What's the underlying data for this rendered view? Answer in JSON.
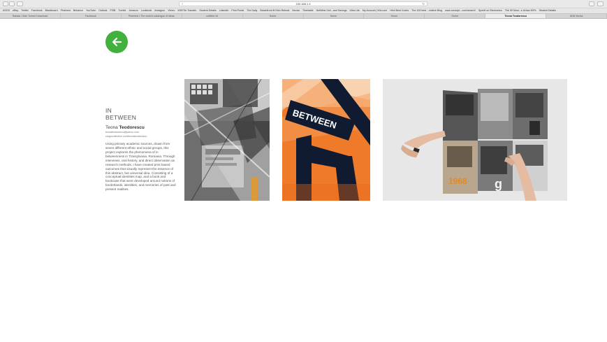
{
  "browser": {
    "url": "192.168.1.4",
    "bookmarks": [
      "ASOS",
      "eBay",
      "Twitter",
      "Facebook",
      "Blackboard",
      "Pinterest",
      "Behance",
      "YouTube",
      "Outlook",
      "FISB",
      "Tumblr",
      "Amazon",
      "Lookbook",
      "Instagrue",
      "Vimeo",
      "Wifi File Transfer",
      "Student Details",
      "LinkedIn",
      "Print Portal",
      "The Daily",
      "Beachfront B+Nim Retreat",
      "Nectar",
      "Timetable",
      "NetWest Onli...and Savings",
      "Ultra Lite",
      "My Account | Wix.com",
      "Html Best Codes",
      "The 100 best ...reative Blog",
      "www.concept...com/search/",
      "Sportif on Electronics",
      "The 50 Most...e Urban 50Fx",
      "Student Details"
    ],
    "tabs": [
      {
        "label": "Rakata / Man Torrent Download",
        "active": false
      },
      {
        "label": "Facebook",
        "active": false
      },
      {
        "label": "Pinterest • The world's catalogue of ideas",
        "active": false
      },
      {
        "label": "untitled 16",
        "active": false
      },
      {
        "label": "Home",
        "active": false
      },
      {
        "label": "Home",
        "active": false
      },
      {
        "label": "Home",
        "active": false
      },
      {
        "label": "Home",
        "active": false
      },
      {
        "label": "Teona Teodorescu",
        "active": true
      },
      {
        "label": "ANN Works",
        "active": false
      }
    ]
  },
  "back_button": {
    "icon": "arrow-left-icon",
    "color": "#41b03c"
  },
  "project": {
    "title_line1": "IN",
    "title_line2": "BETWEEN",
    "author_first": "Teona ",
    "author_last": "Teodorescu",
    "email": "teonateodorescu@yahoo.com",
    "website": "cargocollective.com/teonateodorescu",
    "description": "Using primary academic sources, drawn from seven different ethnic and social groups, this project explores the phenomena of in betweenness in Transylvania, Romania. Through interviews, oral history, and direct observation as research methods, I have created print based outcomes that visually represent the essence of this abstract, but universal idea. Consisting of a conceptual identities map, and a book and bookcase that were developed around notions of borderlands, identities, and memories of past and present realities."
  },
  "images": [
    {
      "name": "collage-print",
      "text": ""
    },
    {
      "name": "between-typography",
      "text": "BETWEEN"
    },
    {
      "name": "foldout-book",
      "text": "1968"
    }
  ]
}
